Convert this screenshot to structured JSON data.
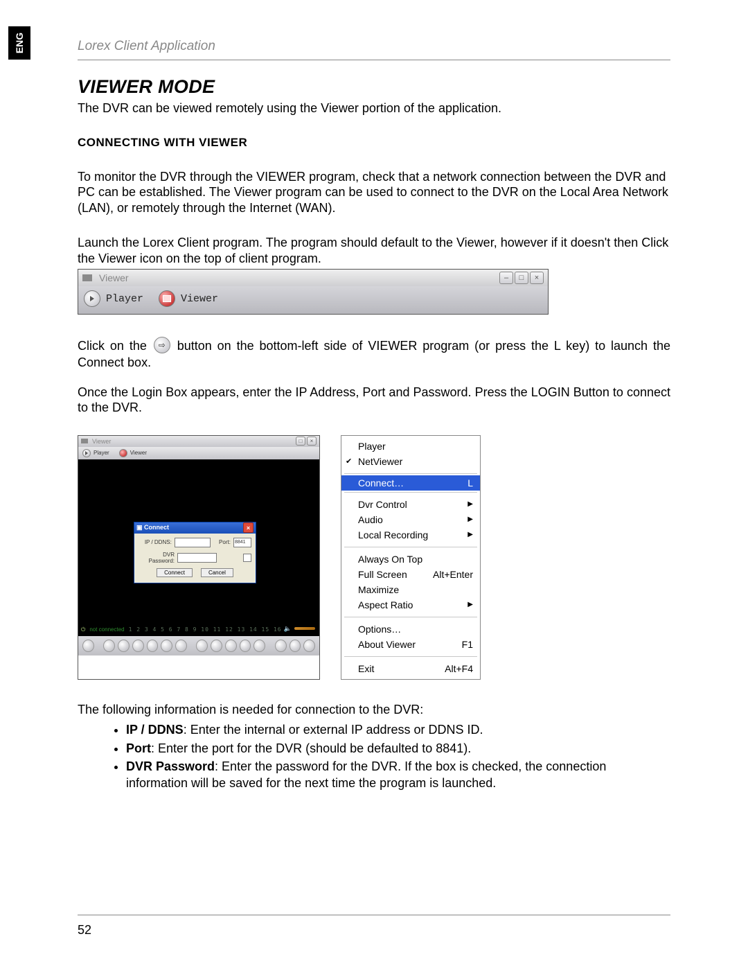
{
  "lang_tab": "ENG",
  "header": "Lorex Client Application",
  "section_title": "VIEWER MODE",
  "intro": "The DVR can be viewed remotely using the Viewer portion of the application.",
  "sub_heading": "CONNECTING WITH VIEWER",
  "para1": "To monitor the DVR through the VIEWER program, check that a network connection between the DVR and PC can be established. The Viewer program can be used to connect to the DVR on the Local Area Network (LAN), or remotely through the Internet (WAN).",
  "para2": "Launch the Lorex Client program. The program should default to the Viewer, however if it doesn't then Click the Viewer icon on the top of client program.",
  "toolbar": {
    "title": "Viewer",
    "player": "Player",
    "viewer": "Viewer"
  },
  "para3_a": "Click on the ",
  "para3_b": " button on the bottom-left side of VIEWER program (or press the L key) to launch the Connect box.",
  "para4": "Once the Login Box appears, enter the IP Address, Port and Password. Press the LOGIN Button to connect to the DVR.",
  "viewer_fig": {
    "title": "Viewer",
    "tab_player": "Player",
    "tab_viewer": "Viewer",
    "connect": {
      "title": "Connect",
      "ip_label": "IP / DDNS:",
      "port_label": "Port:",
      "port_value": "8841",
      "pw_label": "DVR Password:",
      "btn_connect": "Connect",
      "btn_cancel": "Cancel"
    },
    "status": "not connected"
  },
  "menu": {
    "player": "Player",
    "netviewer": "NetViewer",
    "connect": "Connect…",
    "connect_key": "L",
    "dvr_control": "Dvr Control",
    "audio": "Audio",
    "local_recording": "Local Recording",
    "always_on_top": "Always On Top",
    "full_screen": "Full Screen",
    "full_screen_key": "Alt+Enter",
    "maximize": "Maximize",
    "aspect_ratio": "Aspect Ratio",
    "options": "Options…",
    "about": "About Viewer",
    "about_key": "F1",
    "exit": "Exit",
    "exit_key": "Alt+F4"
  },
  "para5": "The following information is needed for connection to the DVR:",
  "bullets": {
    "b1_label": "IP / DDNS",
    "b1_text": ": Enter the internal or external IP address or DDNS ID.",
    "b2_label": "Port",
    "b2_text": ": Enter the port for the DVR (should be defaulted to 8841).",
    "b3_label": "DVR Password",
    "b3_text": ": Enter the password for the DVR. If the box is checked, the connection information will be saved for the next time the program is launched."
  },
  "page_number": "52"
}
